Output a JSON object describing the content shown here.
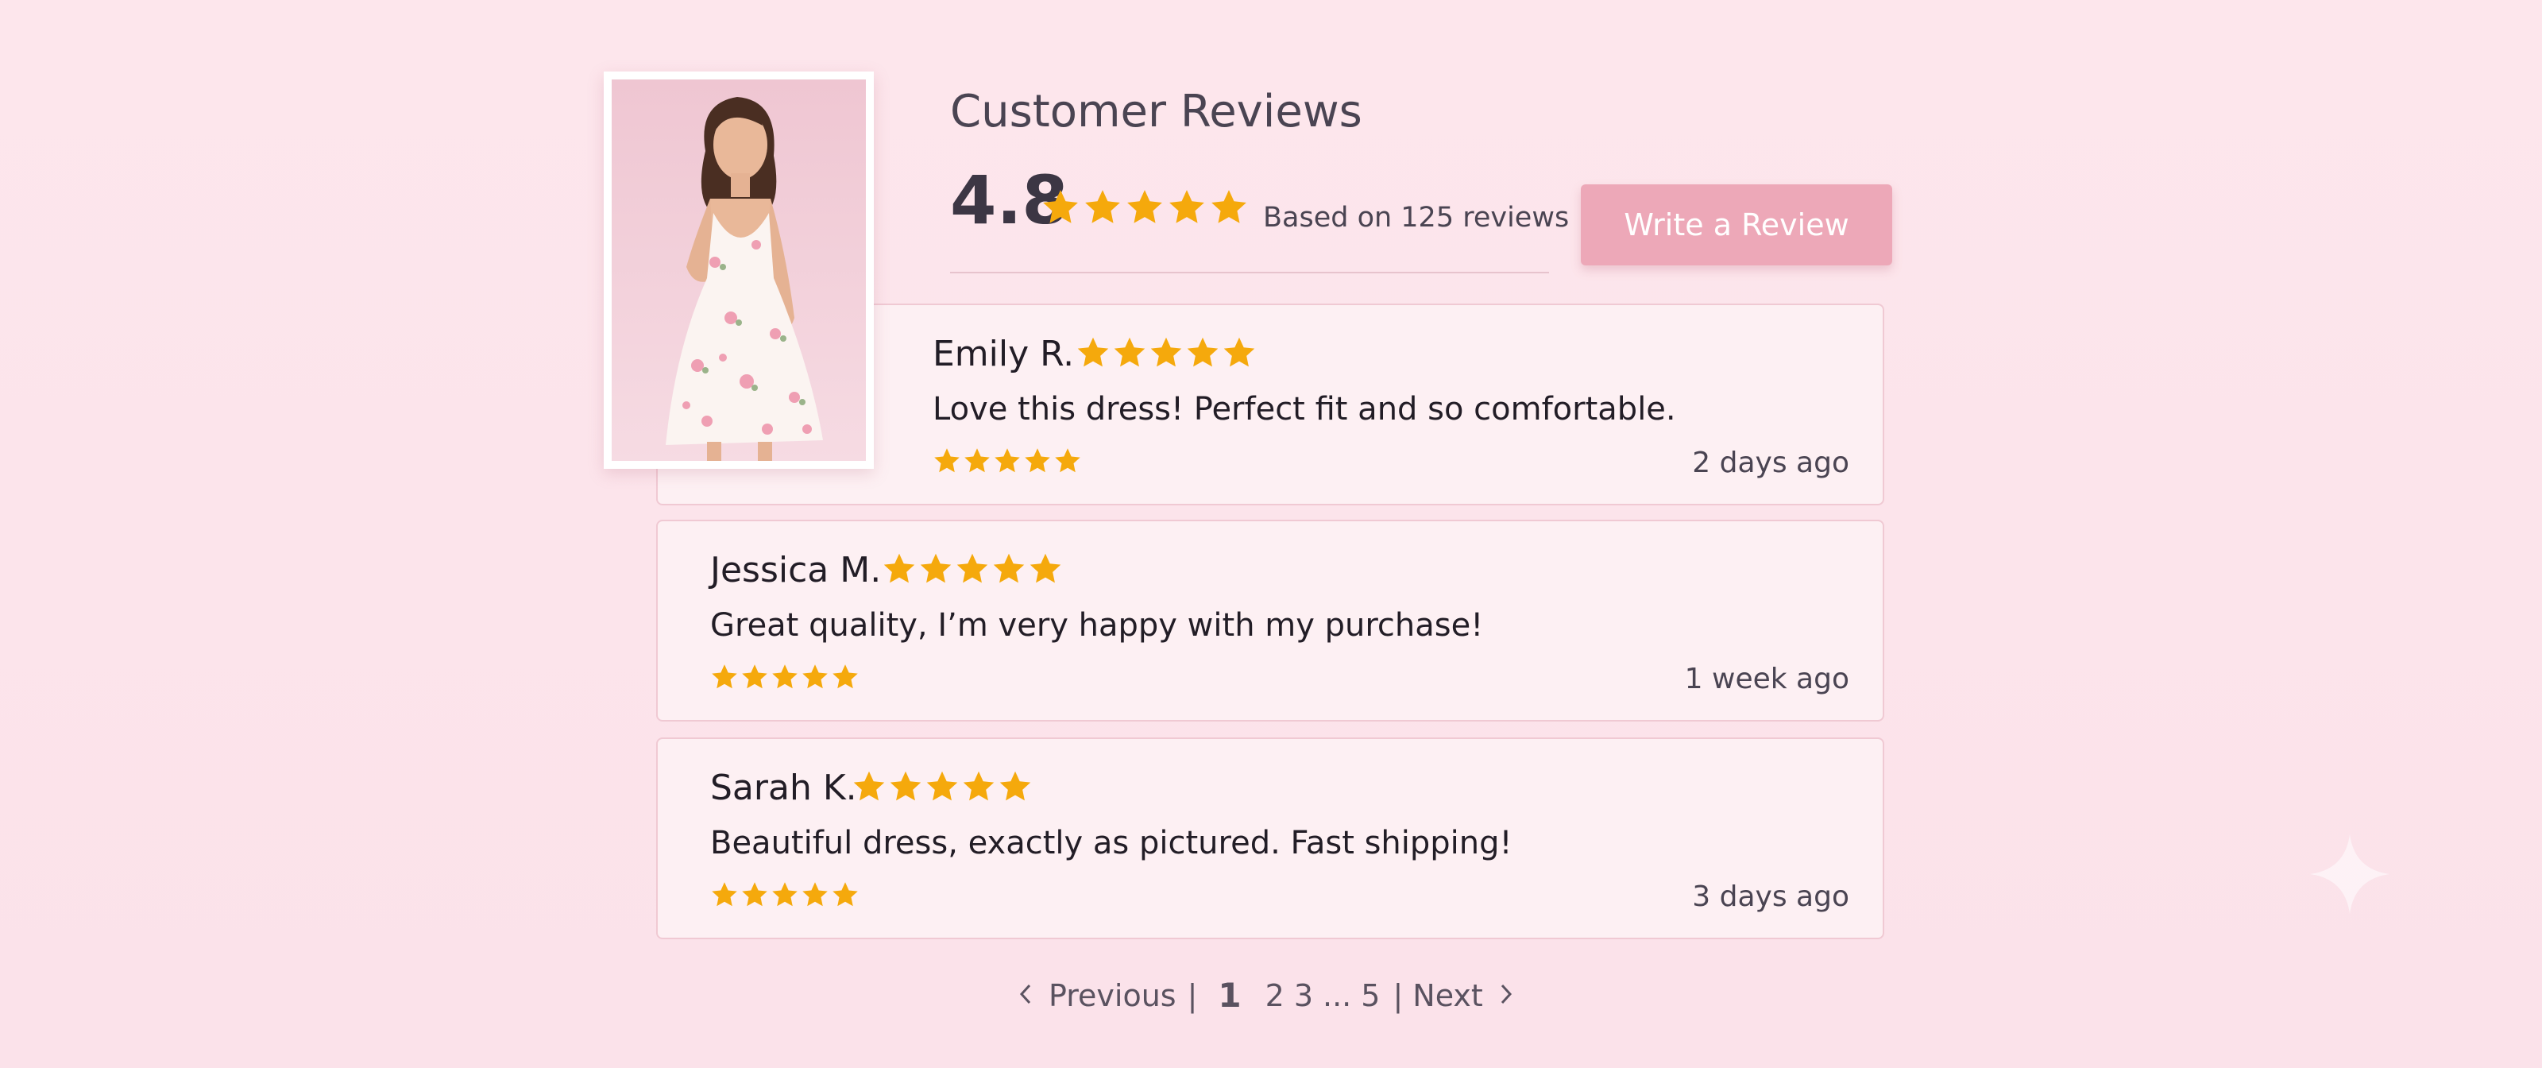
{
  "header": {
    "title": "Customer Reviews",
    "average_rating": "4.8",
    "average_stars": 5,
    "based_on": "Based on 125 reviews",
    "write_review_label": "Write a Review"
  },
  "product_image": {
    "icon": "floral-dress-photo"
  },
  "reviews": [
    {
      "name": "Emily R.",
      "stars": 5,
      "text": "Love this dress! Perfect fit and so comfortable.",
      "time": "2 days ago"
    },
    {
      "name": "Jessica M.",
      "stars": 5,
      "text": "Great quality, I’m very happy with my purchase!",
      "time": "1 week ago"
    },
    {
      "name": "Sarah K.",
      "stars": 5,
      "text": "Beautiful dress, exactly as pictured. Fast shipping!",
      "time": "3 days ago"
    }
  ],
  "pagination": {
    "previous_label": "Previous",
    "pages": [
      "1",
      "2",
      "3",
      "...",
      "5"
    ],
    "current_page": "1",
    "next_label": "Next",
    "separator": "|"
  },
  "colors": {
    "background": "#fde6ec",
    "star": "#f5a90c",
    "button": "#eda8b8",
    "card_border": "#f0c9d3"
  }
}
